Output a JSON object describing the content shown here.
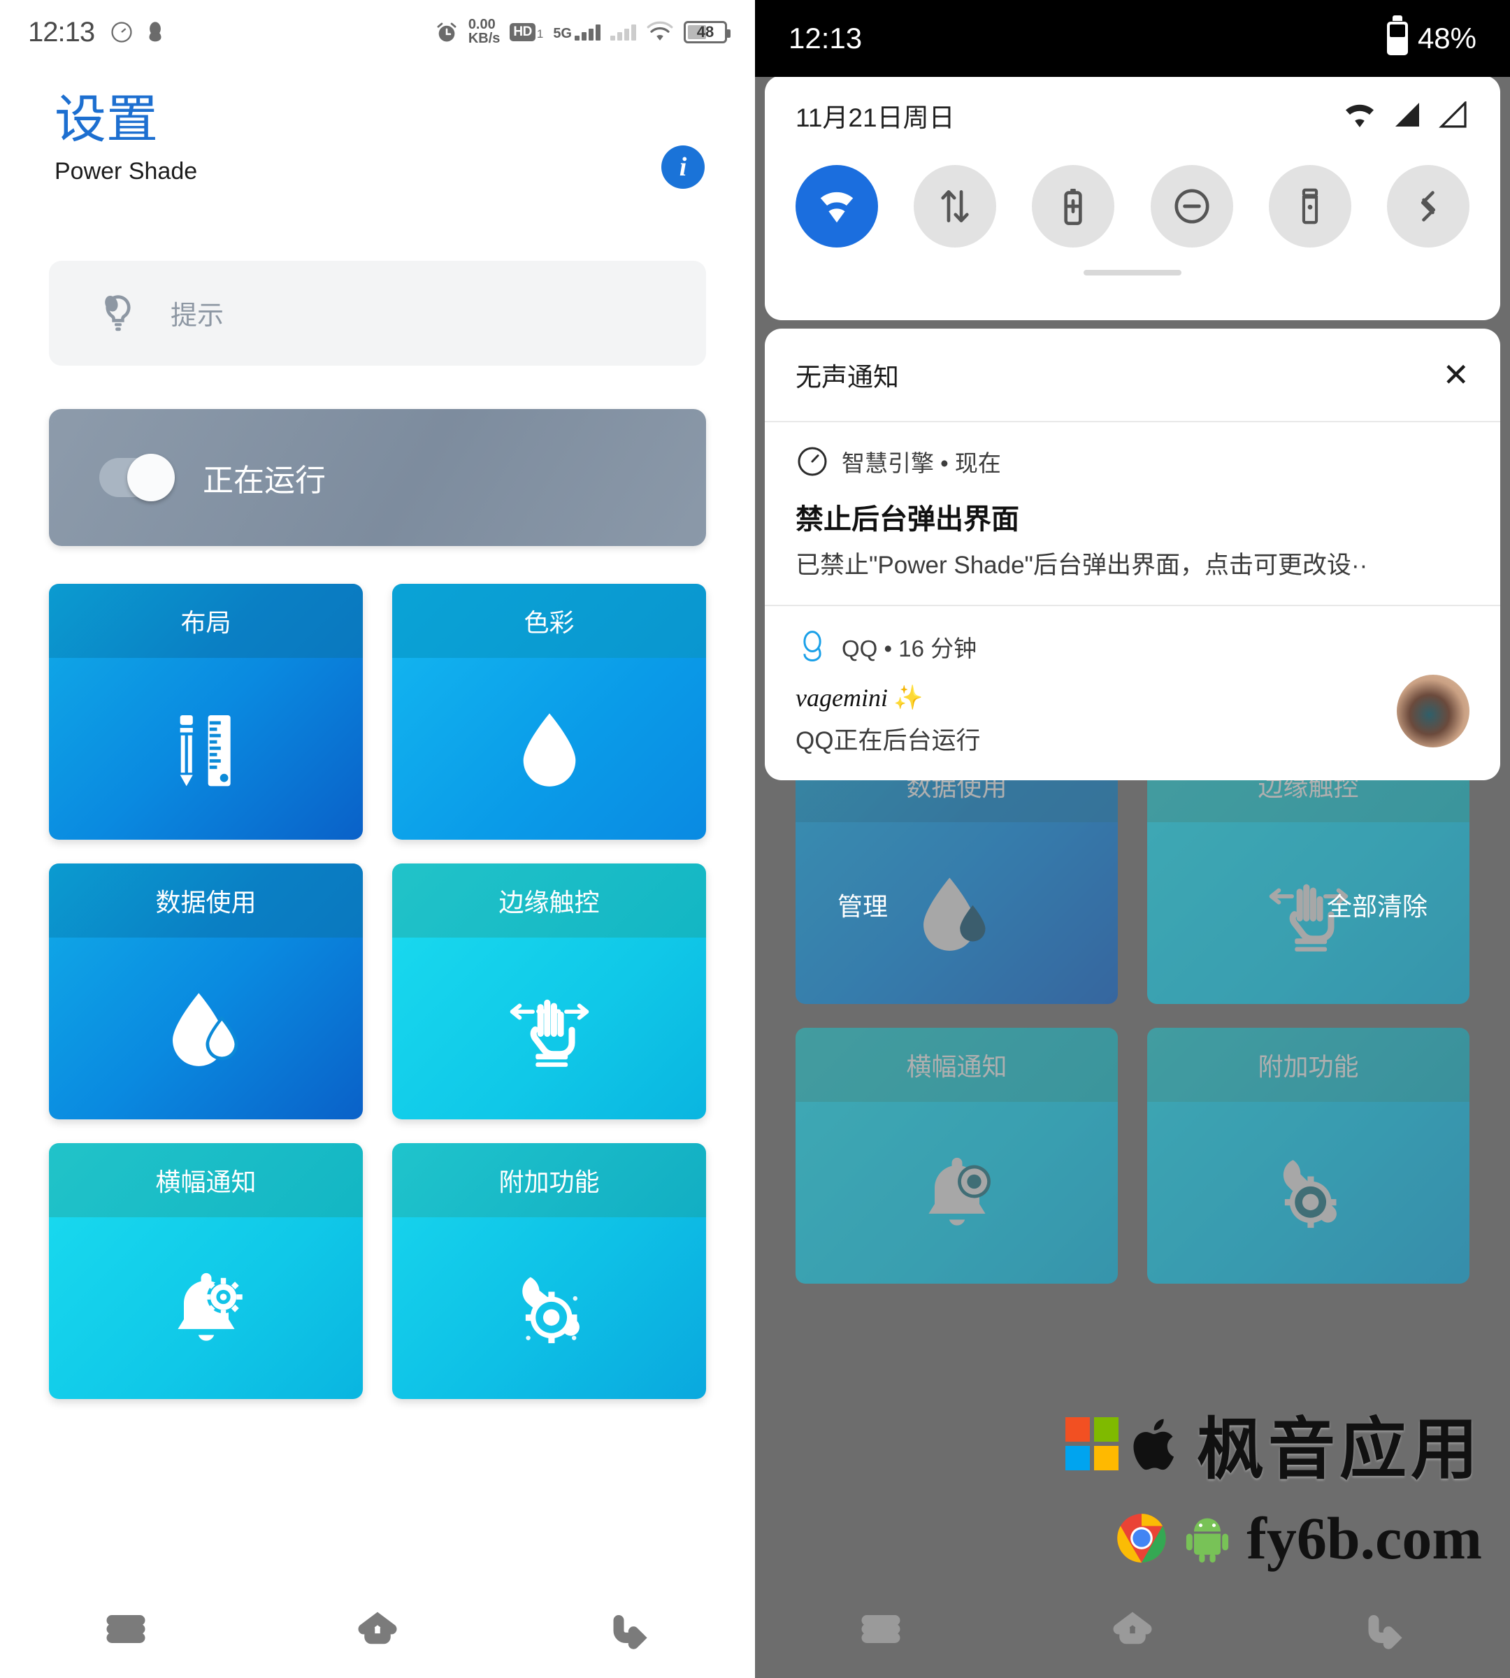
{
  "left": {
    "status": {
      "time": "12:13",
      "net_speed_value": "0.00",
      "net_speed_unit": "KB/s",
      "hd_label": "HD",
      "hd_sub": "1",
      "network_type": "5G",
      "battery_level": "48"
    },
    "header": {
      "title": "设置",
      "subtitle": "Power Shade",
      "info_label": "i"
    },
    "tip": {
      "label": "提示"
    },
    "running": {
      "label": "正在运行",
      "enabled": true
    },
    "tiles": [
      {
        "label": "布局",
        "icon": "pencil-ruler-icon"
      },
      {
        "label": "色彩",
        "icon": "water-drop-icon"
      },
      {
        "label": "数据使用",
        "icon": "data-drop-icon"
      },
      {
        "label": "边缘触控",
        "icon": "edge-swipe-hand-icon"
      },
      {
        "label": "横幅通知",
        "icon": "bell-gear-icon"
      },
      {
        "label": "附加功能",
        "icon": "wrench-gear-icon"
      }
    ],
    "nav": [
      {
        "name": "recents",
        "icon": "menu-icon"
      },
      {
        "name": "home",
        "icon": "home-icon"
      },
      {
        "name": "back",
        "icon": "back-arrow-icon"
      }
    ]
  },
  "right": {
    "status": {
      "time": "12:13",
      "battery_text": "48%"
    },
    "quick_settings": {
      "date": "11月21日周日",
      "signal_icons": [
        "wifi-icon",
        "signal-1-icon",
        "signal-2-icon"
      ],
      "tiles": [
        {
          "name": "wifi",
          "icon": "wifi-icon",
          "active": true
        },
        {
          "name": "mobile-data",
          "icon": "data-arrows-icon",
          "active": false
        },
        {
          "name": "battery-saver",
          "icon": "battery-plus-icon",
          "active": false
        },
        {
          "name": "do-not-disturb",
          "icon": "minus-circle-icon",
          "active": false
        },
        {
          "name": "flashlight",
          "icon": "flashlight-icon",
          "active": false
        },
        {
          "name": "auto-rotate",
          "icon": "rotate-icon",
          "active": false
        }
      ]
    },
    "notifications": {
      "header": "无声通知",
      "close_label": "✕",
      "items": [
        {
          "app": "智慧引擎 • 现在",
          "app_icon": "speedometer-icon",
          "title": "禁止后台弹出界面",
          "body": "已禁止\"Power Shade\"后台弹出界面，点击可更改设··"
        },
        {
          "app": "QQ • 16 分钟",
          "app_icon": "qq-penguin-icon",
          "nickname": "vagemini",
          "nickname_emoji": "✨",
          "body": "QQ正在后台运行",
          "has_avatar": true
        }
      ]
    },
    "footer": {
      "manage": "管理",
      "clear_all": "全部清除"
    },
    "background_tiles": [
      {
        "label": "数据使用",
        "icon": "data-drop-icon"
      },
      {
        "label": "边缘触控",
        "icon": "edge-swipe-hand-icon"
      },
      {
        "label": "横幅通知",
        "icon": "bell-gear-icon"
      },
      {
        "label": "附加功能",
        "icon": "wrench-gear-icon"
      }
    ]
  },
  "watermark": {
    "brand": "枫音应用",
    "url": "fy6b.com"
  },
  "colors": {
    "accent_blue": "#1d6fd0",
    "qs_active": "#1b6ede",
    "running_card": "#8d9bab"
  }
}
